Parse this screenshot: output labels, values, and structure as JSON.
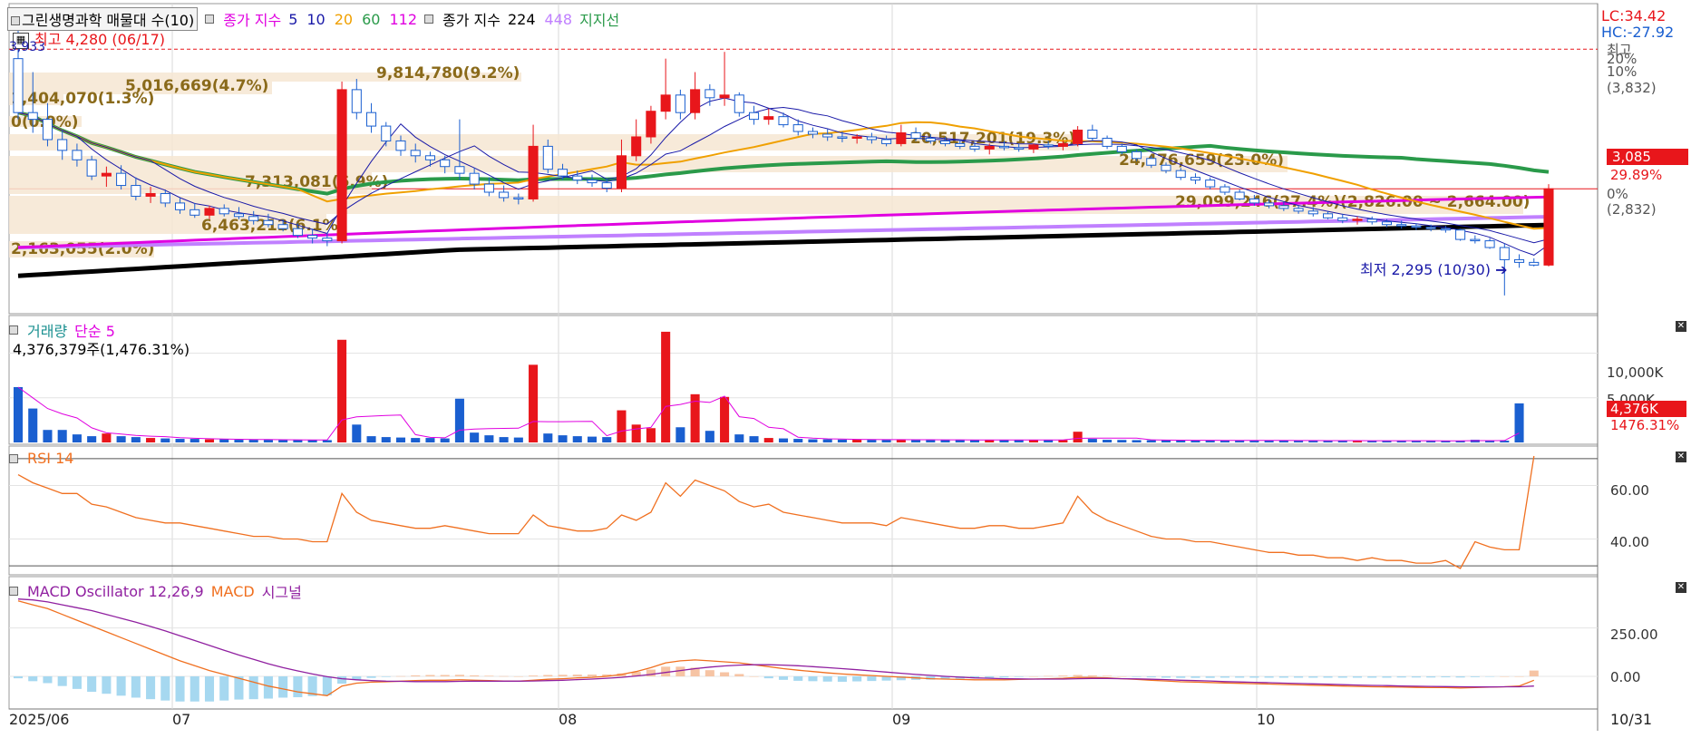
{
  "panel_main": {
    "title": "그린생명과학 매물대 수(10)",
    "legend_ma_prefix": "종가 지수",
    "ma_periods": [
      "5",
      "10",
      "20",
      "60",
      "112"
    ],
    "ma_colors": [
      "#1a1aa8",
      "#1a1aa8",
      "#f0a000",
      "#2a9a4a",
      "#e000e0"
    ],
    "legend_ma2_prefix": "종가 지수",
    "ma2_periods": [
      "224",
      "448"
    ],
    "ma2_colors": [
      "#000000",
      "#c080ff"
    ],
    "support_label": "지지선",
    "high_label": "최고 4,280 (06/17)",
    "low_label": "최저 2,295 (10/30)",
    "corner_value": "3,933",
    "lc": "LC:34.42",
    "hc": "HC:-27.92",
    "right_axis": [
      "최고",
      "20%",
      "10%",
      "(3,832)",
      "0%",
      "(2,832)"
    ],
    "price_tag": "3,085",
    "price_pct": "29.89%",
    "volume_profile": [
      "9,814,780(9.2%)",
      "5,016,669(4.7%)",
      "1,404,070(1.3%)",
      "0(0.0%)",
      "20,517,201(19.3%)",
      "24,476,659(23.0%)",
      "7,313,081(6.9%)",
      "29,099,246(27.4%)(2,826.00 ~ 2,664.00)",
      "6,463,212(6.1%)",
      "2,163,055(2.0%)"
    ]
  },
  "panel_volume": {
    "title": "거래량",
    "ma_label": "단순 5",
    "info": "4,376,379주(1,476.31%)",
    "axis": [
      "10,000K",
      "5,000K"
    ],
    "tag": "4,376K",
    "tag_pct": "1476.31%"
  },
  "panel_rsi": {
    "title": "RSI 14",
    "axis": [
      "60.00",
      "40.00"
    ]
  },
  "panel_macd": {
    "title": "MACD Oscillator 12,26,9",
    "macd_label": "MACD",
    "signal_label": "시그널",
    "axis": [
      "250.00",
      "0.00"
    ]
  },
  "x_axis": [
    "2025/06",
    "07",
    "08",
    "09",
    "10",
    "10/31"
  ],
  "colors": {
    "up": "#e8161b",
    "down": "#1a5fd0",
    "rsi": "#f07020",
    "macd": "#f07020",
    "signal": "#9020a0",
    "osc": "#a6d8f0",
    "osc_pos": "#f6c4a4"
  },
  "chart_data": [
    {
      "type": "candlestick",
      "title": "그린생명과학 매물대 수(10)",
      "x_range": [
        "2025/06",
        "10/31"
      ],
      "y_range": [
        2295,
        4280
      ],
      "high": {
        "value": 4280,
        "date": "06/17"
      },
      "low": {
        "value": 2295,
        "date": "10/30"
      },
      "last": 3085,
      "last_change_pct": 29.89,
      "ohlc": [
        [
          4050,
          4280,
          3600,
          3650
        ],
        [
          3650,
          3950,
          3500,
          3600
        ],
        [
          3600,
          3720,
          3400,
          3450
        ],
        [
          3450,
          3520,
          3300,
          3370
        ],
        [
          3370,
          3420,
          3250,
          3300
        ],
        [
          3300,
          3330,
          3150,
          3180
        ],
        [
          3180,
          3250,
          3100,
          3200
        ],
        [
          3200,
          3260,
          3080,
          3110
        ],
        [
          3110,
          3170,
          3000,
          3030
        ],
        [
          3030,
          3100,
          2980,
          3050
        ],
        [
          3050,
          3080,
          2950,
          2980
        ],
        [
          2980,
          3020,
          2900,
          2930
        ],
        [
          2930,
          2980,
          2870,
          2890
        ],
        [
          2890,
          2960,
          2860,
          2940
        ],
        [
          2940,
          2970,
          2880,
          2900
        ],
        [
          2900,
          2950,
          2860,
          2880
        ],
        [
          2880,
          2920,
          2820,
          2850
        ],
        [
          2850,
          2900,
          2800,
          2820
        ],
        [
          2820,
          2860,
          2770,
          2790
        ],
        [
          2790,
          2830,
          2720,
          2740
        ],
        [
          2740,
          2790,
          2680,
          2720
        ],
        [
          2720,
          2760,
          2660,
          2700
        ],
        [
          2700,
          3880,
          2680,
          3820
        ],
        [
          3820,
          3900,
          3600,
          3650
        ],
        [
          3650,
          3720,
          3500,
          3550
        ],
        [
          3550,
          3580,
          3400,
          3440
        ],
        [
          3440,
          3480,
          3330,
          3370
        ],
        [
          3370,
          3420,
          3280,
          3330
        ],
        [
          3330,
          3360,
          3250,
          3300
        ],
        [
          3300,
          3330,
          3200,
          3250
        ],
        [
          3250,
          3600,
          3150,
          3200
        ],
        [
          3200,
          3240,
          3080,
          3120
        ],
        [
          3120,
          3170,
          3030,
          3060
        ],
        [
          3060,
          3110,
          2990,
          3020
        ],
        [
          3020,
          3050,
          2970,
          3010
        ],
        [
          3010,
          3560,
          2990,
          3400
        ],
        [
          3400,
          3450,
          3200,
          3230
        ],
        [
          3230,
          3270,
          3150,
          3180
        ],
        [
          3180,
          3220,
          3120,
          3150
        ],
        [
          3150,
          3190,
          3100,
          3130
        ],
        [
          3130,
          3160,
          3060,
          3090
        ],
        [
          3090,
          3450,
          3060,
          3330
        ],
        [
          3330,
          3600,
          3290,
          3470
        ],
        [
          3470,
          3700,
          3420,
          3660
        ],
        [
          3660,
          4050,
          3600,
          3780
        ],
        [
          3780,
          3820,
          3600,
          3650
        ],
        [
          3650,
          3950,
          3600,
          3820
        ],
        [
          3820,
          3860,
          3700,
          3760
        ],
        [
          3760,
          4100,
          3700,
          3780
        ],
        [
          3780,
          3800,
          3620,
          3650
        ],
        [
          3650,
          3700,
          3560,
          3600
        ],
        [
          3600,
          3680,
          3560,
          3620
        ],
        [
          3620,
          3650,
          3540,
          3560
        ],
        [
          3560,
          3600,
          3480,
          3510
        ],
        [
          3510,
          3540,
          3460,
          3490
        ],
        [
          3490,
          3530,
          3440,
          3470
        ],
        [
          3470,
          3510,
          3430,
          3460
        ],
        [
          3460,
          3490,
          3420,
          3470
        ],
        [
          3470,
          3500,
          3420,
          3450
        ],
        [
          3450,
          3480,
          3400,
          3420
        ],
        [
          3420,
          3560,
          3400,
          3500
        ],
        [
          3500,
          3540,
          3440,
          3460
        ],
        [
          3460,
          3490,
          3420,
          3440
        ],
        [
          3440,
          3470,
          3400,
          3420
        ],
        [
          3420,
          3450,
          3380,
          3400
        ],
        [
          3400,
          3430,
          3360,
          3380
        ],
        [
          3380,
          3420,
          3340,
          3400
        ],
        [
          3400,
          3440,
          3370,
          3390
        ],
        [
          3390,
          3420,
          3360,
          3380
        ],
        [
          3380,
          3420,
          3350,
          3410
        ],
        [
          3410,
          3440,
          3380,
          3400
        ],
        [
          3400,
          3440,
          3370,
          3420
        ],
        [
          3420,
          3550,
          3400,
          3520
        ],
        [
          3520,
          3560,
          3440,
          3460
        ],
        [
          3460,
          3480,
          3380,
          3400
        ],
        [
          3400,
          3420,
          3340,
          3360
        ],
        [
          3360,
          3380,
          3290,
          3310
        ],
        [
          3310,
          3330,
          3240,
          3260
        ],
        [
          3260,
          3280,
          3200,
          3220
        ],
        [
          3220,
          3240,
          3150,
          3170
        ],
        [
          3170,
          3200,
          3120,
          3150
        ],
        [
          3150,
          3170,
          3080,
          3100
        ],
        [
          3100,
          3120,
          3040,
          3060
        ],
        [
          3060,
          3080,
          3000,
          3010
        ],
        [
          3010,
          3040,
          2960,
          2980
        ],
        [
          2980,
          3010,
          2940,
          2960
        ],
        [
          2960,
          2990,
          2920,
          2940
        ],
        [
          2940,
          2960,
          2900,
          2920
        ],
        [
          2920,
          2950,
          2880,
          2900
        ],
        [
          2900,
          2920,
          2860,
          2870
        ],
        [
          2870,
          2900,
          2830,
          2850
        ],
        [
          2850,
          2880,
          2820,
          2860
        ],
        [
          2860,
          2880,
          2820,
          2840
        ],
        [
          2840,
          2860,
          2800,
          2820
        ],
        [
          2820,
          2850,
          2790,
          2810
        ],
        [
          2810,
          2830,
          2780,
          2800
        ],
        [
          2800,
          2820,
          2770,
          2790
        ],
        [
          2790,
          2810,
          2760,
          2780
        ],
        [
          2780,
          2790,
          2700,
          2710
        ],
        [
          2710,
          2740,
          2680,
          2700
        ],
        [
          2700,
          2720,
          2640,
          2650
        ],
        [
          2650,
          2680,
          2295,
          2560
        ],
        [
          2560,
          2600,
          2500,
          2540
        ],
        [
          2540,
          2570,
          2510,
          2520
        ],
        [
          2520,
          3120,
          2510,
          3085
        ]
      ],
      "moving_averages": [
        "5",
        "10",
        "20",
        "60",
        "112",
        "224",
        "448"
      ],
      "volume_profile_pct": [
        9.2,
        4.7,
        1.3,
        0.0,
        19.3,
        23.0,
        6.9,
        27.4,
        6.1,
        2.0
      ]
    },
    {
      "type": "bar",
      "title": "거래량",
      "ma": "단순 5",
      "ylim": [
        0,
        13000
      ],
      "unit": "K",
      "last_volume": 4376379,
      "last_pct": 1476.31,
      "values": [
        6200,
        3800,
        1400,
        1400,
        900,
        700,
        1000,
        700,
        600,
        500,
        450,
        400,
        400,
        350,
        350,
        300,
        300,
        300,
        280,
        280,
        260,
        260,
        11500,
        2000,
        700,
        600,
        550,
        500,
        500,
        450,
        4900,
        1100,
        800,
        600,
        550,
        8700,
        1000,
        800,
        700,
        650,
        600,
        3600,
        2000,
        1600,
        12400,
        1700,
        5400,
        1300,
        5100,
        900,
        700,
        500,
        450,
        400,
        350,
        350,
        320,
        320,
        300,
        300,
        320,
        300,
        280,
        280,
        270,
        260,
        260,
        300,
        280,
        260,
        260,
        270,
        1200,
        400,
        300,
        280,
        260,
        250,
        250,
        240,
        240,
        230,
        230,
        220,
        220,
        220,
        210,
        210,
        200,
        200,
        200,
        200,
        190,
        190,
        190,
        190,
        180,
        180,
        180,
        300,
        200,
        200,
        4376
      ]
    },
    {
      "type": "line",
      "title": "RSI 14",
      "ylim": [
        28,
        72
      ],
      "values": [
        64,
        61,
        59,
        57,
        57,
        53,
        52,
        50,
        48,
        47,
        46,
        46,
        45,
        44,
        43,
        42,
        41,
        41,
        40,
        40,
        39,
        39,
        57,
        50,
        47,
        46,
        45,
        44,
        44,
        45,
        44,
        43,
        42,
        42,
        42,
        49,
        45,
        44,
        43,
        43,
        44,
        49,
        47,
        50,
        61,
        56,
        62,
        60,
        58,
        54,
        52,
        53,
        50,
        49,
        48,
        47,
        46,
        46,
        46,
        45,
        48,
        47,
        46,
        45,
        44,
        44,
        45,
        45,
        44,
        44,
        45,
        46,
        56,
        50,
        47,
        45,
        43,
        41,
        40,
        40,
        39,
        39,
        38,
        37,
        36,
        35,
        35,
        34,
        34,
        33,
        33,
        32,
        33,
        32,
        32,
        31,
        31,
        32,
        29,
        39,
        37,
        36,
        36,
        71
      ]
    },
    {
      "type": "line",
      "title": "MACD Oscillator 12,26,9",
      "series_labels": [
        "MACD",
        "시그널"
      ],
      "ylim": [
        -150,
        450
      ],
      "macd": [
        390,
        370,
        350,
        320,
        290,
        260,
        230,
        200,
        170,
        140,
        110,
        80,
        55,
        30,
        10,
        -10,
        -30,
        -50,
        -65,
        -80,
        -90,
        -100,
        -50,
        -35,
        -30,
        -28,
        -25,
        -22,
        -20,
        -20,
        -18,
        -20,
        -22,
        -24,
        -25,
        -20,
        -15,
        -12,
        -8,
        -5,
        0,
        10,
        25,
        45,
        70,
        80,
        85,
        80,
        75,
        70,
        60,
        50,
        40,
        32,
        25,
        18,
        12,
        8,
        4,
        0,
        -4,
        -8,
        -12,
        -14,
        -16,
        -18,
        -18,
        -18,
        -16,
        -14,
        -12,
        -10,
        -5,
        -6,
        -8,
        -12,
        -16,
        -20,
        -24,
        -28,
        -30,
        -32,
        -34,
        -36,
        -38,
        -40,
        -42,
        -44,
        -46,
        -48,
        -50,
        -52,
        -54,
        -55,
        -56,
        -57,
        -58,
        -58,
        -60,
        -58,
        -56,
        -54,
        -50,
        -20
      ],
      "signal": [
        400,
        395,
        385,
        370,
        355,
        340,
        320,
        300,
        280,
        258,
        235,
        210,
        185,
        160,
        135,
        110,
        88,
        65,
        45,
        28,
        12,
        -2,
        -12,
        -18,
        -22,
        -25,
        -26,
        -27,
        -27,
        -27,
        -26,
        -25,
        -25,
        -25,
        -25,
        -24,
        -22,
        -20,
        -17,
        -14,
        -10,
        -5,
        2,
        10,
        20,
        30,
        40,
        48,
        54,
        58,
        60,
        60,
        58,
        55,
        50,
        45,
        40,
        34,
        28,
        22,
        16,
        10,
        5,
        0,
        -4,
        -8,
        -10,
        -12,
        -13,
        -14,
        -14,
        -14,
        -12,
        -11,
        -11,
        -12,
        -13,
        -15,
        -17,
        -20,
        -22,
        -24,
        -27,
        -29,
        -31,
        -33,
        -35,
        -37,
        -39,
        -41,
        -43,
        -45,
        -47,
        -48,
        -50,
        -51,
        -52,
        -53,
        -54,
        -55,
        -55,
        -54,
        -54,
        -50
      ],
      "oscillator": [
        -10,
        -25,
        -35,
        -50,
        -65,
        -80,
        -90,
        -100,
        -110,
        -118,
        -125,
        -130,
        -130,
        -130,
        -125,
        -120,
        -118,
        -115,
        -110,
        -108,
        -102,
        -98,
        -38,
        -17,
        -8,
        -3,
        1,
        5,
        7,
        7,
        8,
        5,
        3,
        1,
        0,
        4,
        7,
        8,
        9,
        9,
        10,
        15,
        23,
        35,
        50,
        50,
        45,
        32,
        21,
        12,
        0,
        -10,
        -18,
        -23,
        -25,
        -27,
        -28,
        -26,
        -24,
        -22,
        -20,
        -18,
        -17,
        -14,
        -12,
        -10,
        -8,
        -6,
        -3,
        0,
        2,
        4,
        7,
        5,
        3,
        0,
        -3,
        -5,
        -7,
        -8,
        -8,
        -8,
        -7,
        -7,
        -7,
        -7,
        -7,
        -7,
        -7,
        -7,
        -7,
        -7,
        -7,
        -7,
        -6,
        -6,
        -6,
        -5,
        -6,
        -4,
        -2,
        0,
        0,
        30
      ]
    }
  ]
}
